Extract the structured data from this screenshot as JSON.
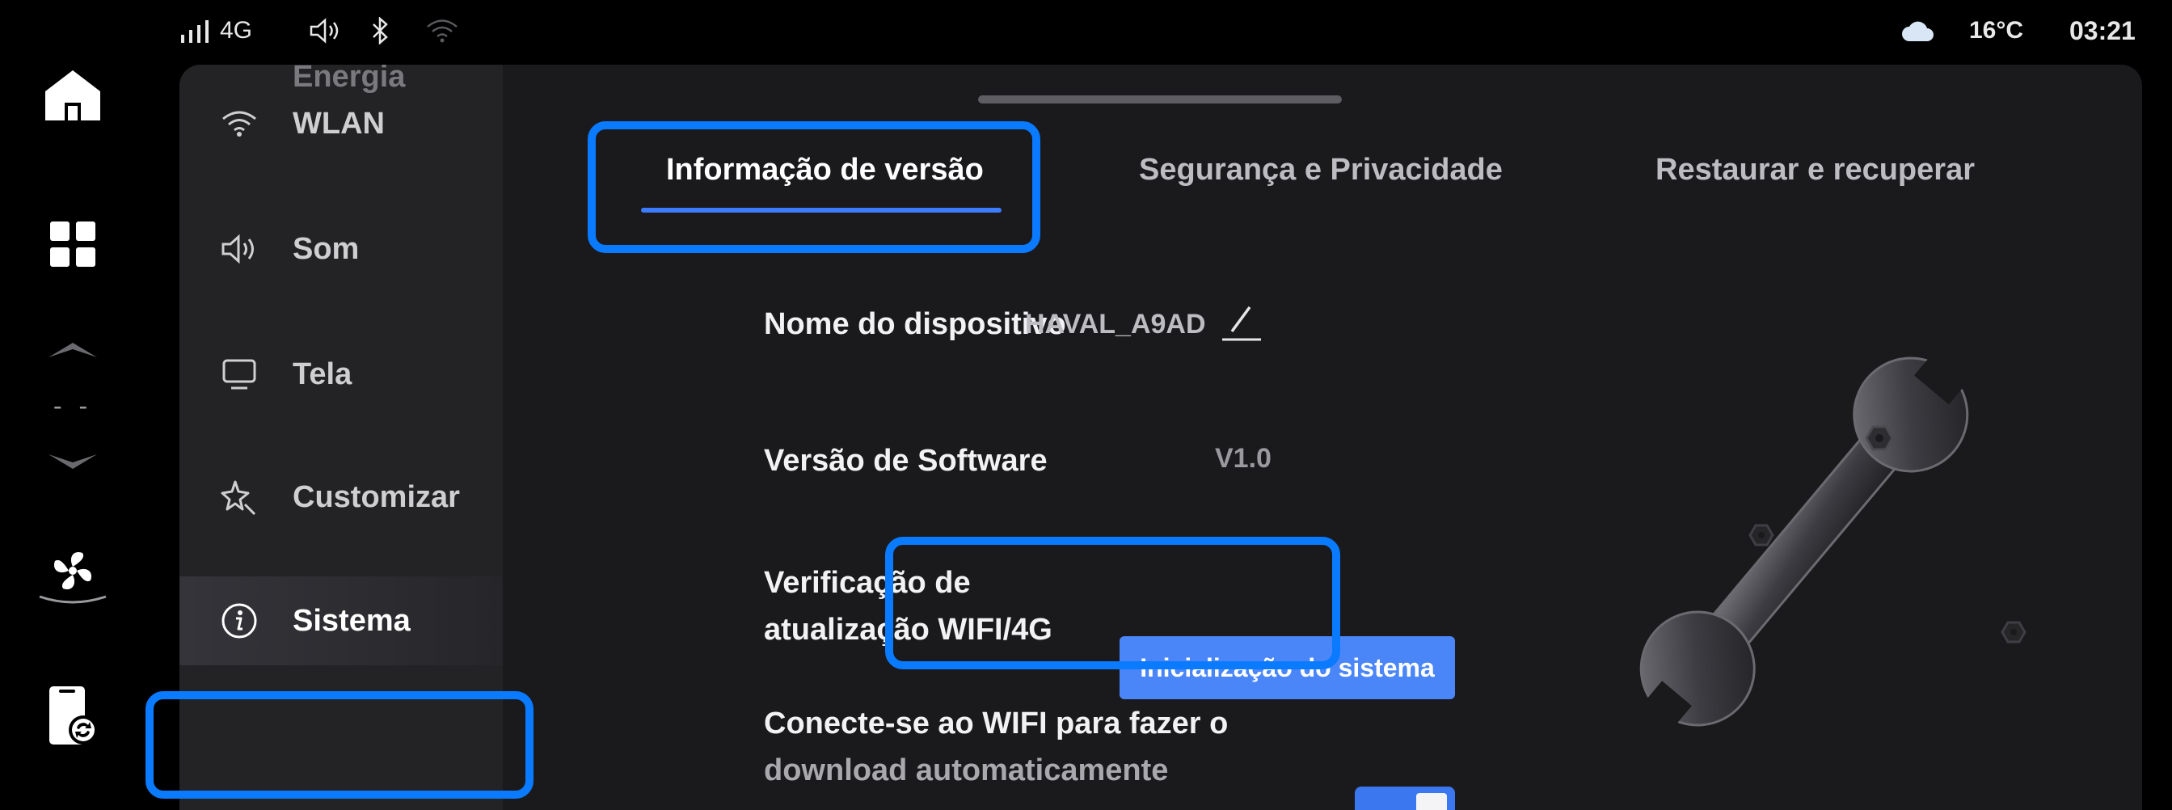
{
  "status_bar": {
    "network": "4G",
    "temperature": "16°C",
    "time": "03:21",
    "icons": [
      "signal-icon",
      "volume-icon",
      "bluetooth-icon",
      "wifi-icon",
      "weather-cloud-icon"
    ]
  },
  "dock": {
    "items": [
      "home-icon",
      "apps-grid-icon",
      "chevron-up-icon",
      "chevron-down-icon",
      "fan-icon",
      "phone-sync-icon"
    ],
    "fan_level": "- -"
  },
  "sidebar": {
    "partial_item": "Energia",
    "items": [
      {
        "label": "WLAN",
        "icon": "wifi-icon"
      },
      {
        "label": "Som",
        "icon": "speaker-icon"
      },
      {
        "label": "Tela",
        "icon": "monitor-icon"
      },
      {
        "label": "Customizar",
        "icon": "sparkle-icon"
      },
      {
        "label": "Sistema",
        "icon": "info-icon",
        "active": true
      }
    ]
  },
  "tabs": [
    {
      "label": "Informação de versão",
      "active": true
    },
    {
      "label": "Segurança e Privacidade"
    },
    {
      "label": "Restaurar e recuperar"
    }
  ],
  "settings": {
    "device_name_label": "Nome do dispositivo",
    "device_name_value": "HAVAL_A9AD",
    "software_version_label": "Versão de Software",
    "software_version_value": "V1.0",
    "update_check_label_line1": "Verificação de",
    "update_check_label_line2": "atualização WIFI/4G",
    "update_button": "Inicialização do sistema",
    "auto_download_label_line1": "Conecte-se ao WIFI para fazer o",
    "auto_download_label_line2": "download automaticamente",
    "auto_download_enabled": true
  },
  "colors": {
    "accent": "#3d7bff",
    "button": "#4a86f7",
    "highlight_box": "#0a7aff",
    "panel_bg": "#1a1a1c",
    "sidebar_bg": "#232325"
  }
}
